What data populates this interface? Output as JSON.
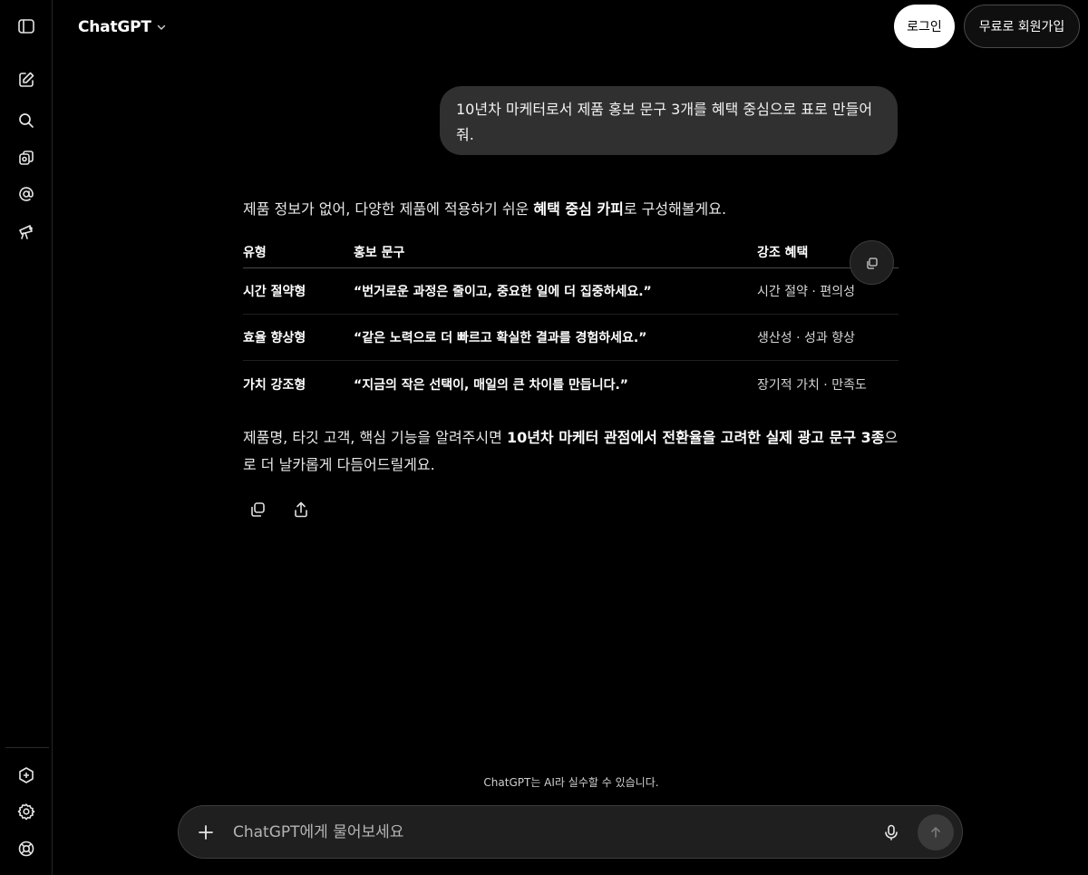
{
  "header": {
    "model_name": "ChatGPT",
    "login_label": "로그인",
    "signup_label": "무료로 회원가입"
  },
  "sidebar": {
    "icons": [
      "sidebar-toggle-icon",
      "new-chat-icon",
      "search-icon",
      "library-icon",
      "at-sign-icon",
      "explore-icon",
      "upgrade-icon",
      "settings-icon",
      "help-icon"
    ]
  },
  "conversation": {
    "user_message": "10년차 마케터로서 제품 홍보 문구 3개를 혜택 중심으로 표로 만들어 줘.",
    "intro_pre": "제품 정보가 없어, 다양한 제품에 적용하기 쉬운 ",
    "intro_bold": "혜택 중심 카피",
    "intro_post": "로 구성해볼게요.",
    "table": {
      "headers": [
        "유형",
        "홍보 문구",
        "강조 혜택"
      ],
      "rows": [
        [
          "시간 절약형",
          "“번거로운 과정은 줄이고, 중요한 일에 더 집중하세요.”",
          "시간 절약 · 편의성"
        ],
        [
          "효율 향상형",
          "“같은 노력으로 더 빠르고 확실한 결과를 경험하세요.”",
          "생산성 · 성과 향상"
        ],
        [
          "가치 강조형",
          "“지금의 작은 선택이, 매일의 큰 차이를 만듭니다.”",
          "장기적 가치 · 만족도"
        ]
      ]
    },
    "outro_pre": "제품명, 타깃 고객, 핵심 기능을 알려주시면 ",
    "outro_bold": "10년차 마케터 관점에서 전환율을 고려한 실제 광고 문구 3종",
    "outro_post": "으로 더 날카롭게 다듬어드릴게요."
  },
  "footer": {
    "disclaimer": "ChatGPT는 AI라 실수할 수 있습니다.",
    "composer_placeholder": "ChatGPT에게 물어보세요"
  }
}
